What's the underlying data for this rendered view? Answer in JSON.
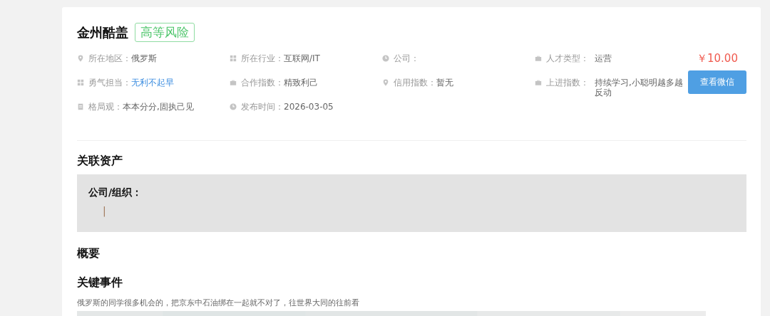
{
  "title": "金州酷盖",
  "risk_tag": "高等风险",
  "info": [
    {
      "kind": "pin",
      "label": "所在地区：",
      "value": "俄罗斯",
      "link": false
    },
    {
      "kind": "grid",
      "label": "所在行业：",
      "value": "互联网/IT",
      "link": false
    },
    {
      "kind": "clock",
      "label": "公司："
    },
    {
      "kind": "case",
      "label": "人才类型：",
      "value": "运营",
      "link": false
    },
    {
      "kind": "grid",
      "label": "勇气担当：",
      "value": "无利不起早",
      "link": true
    },
    {
      "kind": "case",
      "label": "合作指数：",
      "value": "精致利己",
      "link": false
    },
    {
      "kind": "pin",
      "label": "信用指数：",
      "value": "暂无",
      "link": false
    },
    {
      "kind": "case",
      "label": "上进指数：",
      "value": "持续学习,小聪明越多越反动",
      "link": false
    },
    {
      "kind": "note",
      "label": "格局观：",
      "value": "本本分分,固执己见",
      "link": false
    },
    {
      "kind": "clock",
      "label": "发布时间：",
      "value": "2026-03-05",
      "link": false
    }
  ],
  "price": "￥10.00",
  "button": "查看微信",
  "assets": {
    "heading": "关联资产",
    "label": "公司/组织：",
    "marker": "|"
  },
  "summary": {
    "heading": "概要"
  },
  "events": {
    "heading": "关键事件",
    "text": "俄罗斯的同学很多机会的，把京东中石油绑在一起就不对了，往世界大同的往前看"
  }
}
